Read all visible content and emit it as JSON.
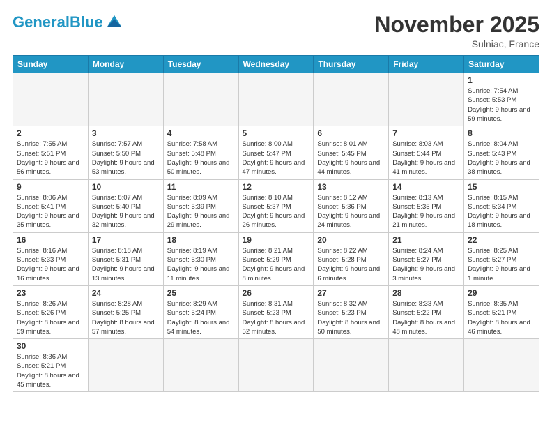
{
  "header": {
    "logo_general": "General",
    "logo_blue": "Blue",
    "month_title": "November 2025",
    "location": "Sulniac, France"
  },
  "weekdays": [
    "Sunday",
    "Monday",
    "Tuesday",
    "Wednesday",
    "Thursday",
    "Friday",
    "Saturday"
  ],
  "weeks": [
    [
      {
        "day": "",
        "empty": true
      },
      {
        "day": "",
        "empty": true
      },
      {
        "day": "",
        "empty": true
      },
      {
        "day": "",
        "empty": true
      },
      {
        "day": "",
        "empty": true
      },
      {
        "day": "",
        "empty": true
      },
      {
        "day": "1",
        "sunrise": "Sunrise: 7:54 AM",
        "sunset": "Sunset: 5:53 PM",
        "daylight": "Daylight: 9 hours and 59 minutes."
      }
    ],
    [
      {
        "day": "2",
        "sunrise": "Sunrise: 7:55 AM",
        "sunset": "Sunset: 5:51 PM",
        "daylight": "Daylight: 9 hours and 56 minutes."
      },
      {
        "day": "3",
        "sunrise": "Sunrise: 7:57 AM",
        "sunset": "Sunset: 5:50 PM",
        "daylight": "Daylight: 9 hours and 53 minutes."
      },
      {
        "day": "4",
        "sunrise": "Sunrise: 7:58 AM",
        "sunset": "Sunset: 5:48 PM",
        "daylight": "Daylight: 9 hours and 50 minutes."
      },
      {
        "day": "5",
        "sunrise": "Sunrise: 8:00 AM",
        "sunset": "Sunset: 5:47 PM",
        "daylight": "Daylight: 9 hours and 47 minutes."
      },
      {
        "day": "6",
        "sunrise": "Sunrise: 8:01 AM",
        "sunset": "Sunset: 5:45 PM",
        "daylight": "Daylight: 9 hours and 44 minutes."
      },
      {
        "day": "7",
        "sunrise": "Sunrise: 8:03 AM",
        "sunset": "Sunset: 5:44 PM",
        "daylight": "Daylight: 9 hours and 41 minutes."
      },
      {
        "day": "8",
        "sunrise": "Sunrise: 8:04 AM",
        "sunset": "Sunset: 5:43 PM",
        "daylight": "Daylight: 9 hours and 38 minutes."
      }
    ],
    [
      {
        "day": "9",
        "sunrise": "Sunrise: 8:06 AM",
        "sunset": "Sunset: 5:41 PM",
        "daylight": "Daylight: 9 hours and 35 minutes."
      },
      {
        "day": "10",
        "sunrise": "Sunrise: 8:07 AM",
        "sunset": "Sunset: 5:40 PM",
        "daylight": "Daylight: 9 hours and 32 minutes."
      },
      {
        "day": "11",
        "sunrise": "Sunrise: 8:09 AM",
        "sunset": "Sunset: 5:39 PM",
        "daylight": "Daylight: 9 hours and 29 minutes."
      },
      {
        "day": "12",
        "sunrise": "Sunrise: 8:10 AM",
        "sunset": "Sunset: 5:37 PM",
        "daylight": "Daylight: 9 hours and 26 minutes."
      },
      {
        "day": "13",
        "sunrise": "Sunrise: 8:12 AM",
        "sunset": "Sunset: 5:36 PM",
        "daylight": "Daylight: 9 hours and 24 minutes."
      },
      {
        "day": "14",
        "sunrise": "Sunrise: 8:13 AM",
        "sunset": "Sunset: 5:35 PM",
        "daylight": "Daylight: 9 hours and 21 minutes."
      },
      {
        "day": "15",
        "sunrise": "Sunrise: 8:15 AM",
        "sunset": "Sunset: 5:34 PM",
        "daylight": "Daylight: 9 hours and 18 minutes."
      }
    ],
    [
      {
        "day": "16",
        "sunrise": "Sunrise: 8:16 AM",
        "sunset": "Sunset: 5:33 PM",
        "daylight": "Daylight: 9 hours and 16 minutes."
      },
      {
        "day": "17",
        "sunrise": "Sunrise: 8:18 AM",
        "sunset": "Sunset: 5:31 PM",
        "daylight": "Daylight: 9 hours and 13 minutes."
      },
      {
        "day": "18",
        "sunrise": "Sunrise: 8:19 AM",
        "sunset": "Sunset: 5:30 PM",
        "daylight": "Daylight: 9 hours and 11 minutes."
      },
      {
        "day": "19",
        "sunrise": "Sunrise: 8:21 AM",
        "sunset": "Sunset: 5:29 PM",
        "daylight": "Daylight: 9 hours and 8 minutes."
      },
      {
        "day": "20",
        "sunrise": "Sunrise: 8:22 AM",
        "sunset": "Sunset: 5:28 PM",
        "daylight": "Daylight: 9 hours and 6 minutes."
      },
      {
        "day": "21",
        "sunrise": "Sunrise: 8:24 AM",
        "sunset": "Sunset: 5:27 PM",
        "daylight": "Daylight: 9 hours and 3 minutes."
      },
      {
        "day": "22",
        "sunrise": "Sunrise: 8:25 AM",
        "sunset": "Sunset: 5:27 PM",
        "daylight": "Daylight: 9 hours and 1 minute."
      }
    ],
    [
      {
        "day": "23",
        "sunrise": "Sunrise: 8:26 AM",
        "sunset": "Sunset: 5:26 PM",
        "daylight": "Daylight: 8 hours and 59 minutes."
      },
      {
        "day": "24",
        "sunrise": "Sunrise: 8:28 AM",
        "sunset": "Sunset: 5:25 PM",
        "daylight": "Daylight: 8 hours and 57 minutes."
      },
      {
        "day": "25",
        "sunrise": "Sunrise: 8:29 AM",
        "sunset": "Sunset: 5:24 PM",
        "daylight": "Daylight: 8 hours and 54 minutes."
      },
      {
        "day": "26",
        "sunrise": "Sunrise: 8:31 AM",
        "sunset": "Sunset: 5:23 PM",
        "daylight": "Daylight: 8 hours and 52 minutes."
      },
      {
        "day": "27",
        "sunrise": "Sunrise: 8:32 AM",
        "sunset": "Sunset: 5:23 PM",
        "daylight": "Daylight: 8 hours and 50 minutes."
      },
      {
        "day": "28",
        "sunrise": "Sunrise: 8:33 AM",
        "sunset": "Sunset: 5:22 PM",
        "daylight": "Daylight: 8 hours and 48 minutes."
      },
      {
        "day": "29",
        "sunrise": "Sunrise: 8:35 AM",
        "sunset": "Sunset: 5:21 PM",
        "daylight": "Daylight: 8 hours and 46 minutes."
      }
    ],
    [
      {
        "day": "30",
        "sunrise": "Sunrise: 8:36 AM",
        "sunset": "Sunset: 5:21 PM",
        "daylight": "Daylight: 8 hours and 45 minutes."
      },
      {
        "day": "",
        "empty": true
      },
      {
        "day": "",
        "empty": true
      },
      {
        "day": "",
        "empty": true
      },
      {
        "day": "",
        "empty": true
      },
      {
        "day": "",
        "empty": true
      },
      {
        "day": "",
        "empty": true
      }
    ]
  ]
}
